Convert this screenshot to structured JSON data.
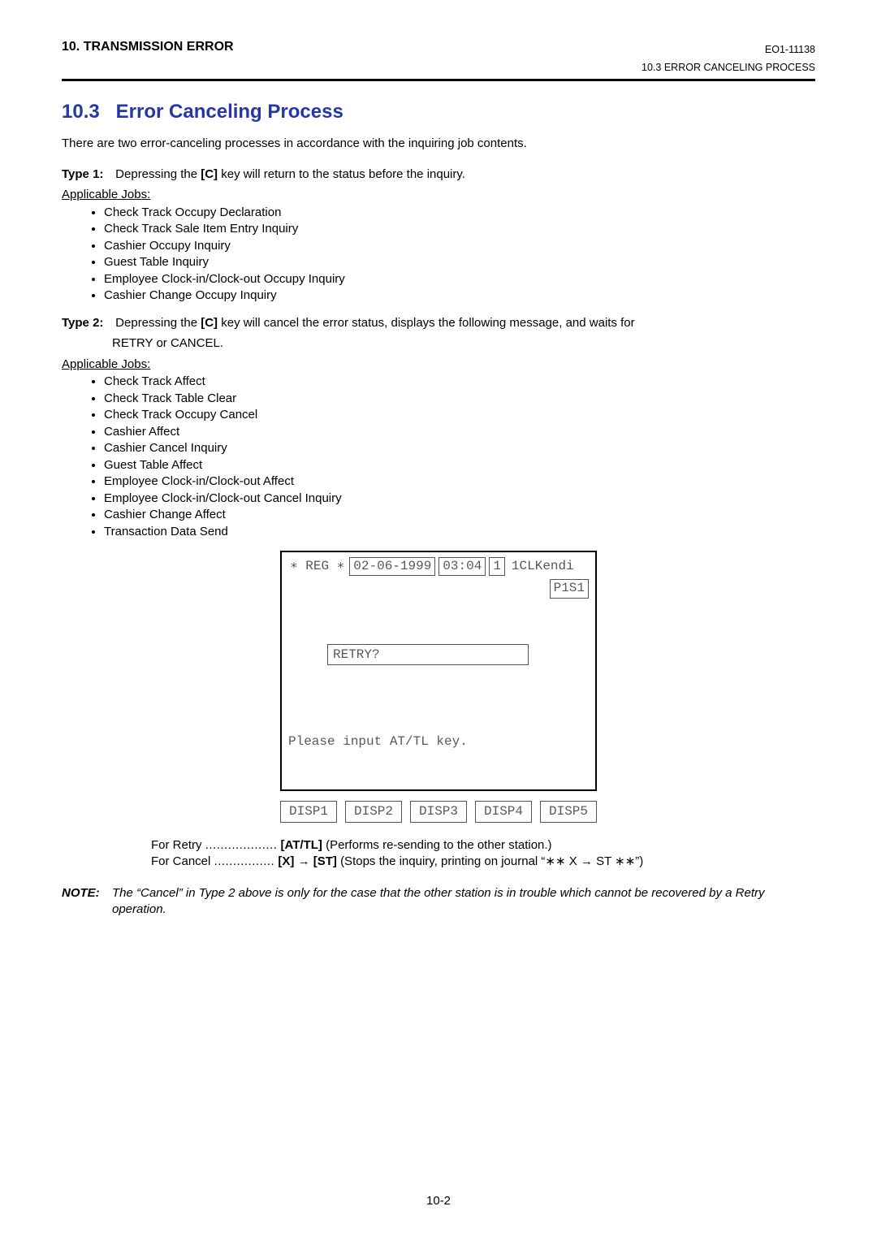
{
  "header": {
    "chapter": "10.  TRANSMISSION ERROR",
    "doc_id": "EO1-11138",
    "sub_right": "10.3  ERROR CANCELING PROCESS"
  },
  "section": {
    "number": "10.3",
    "title": "Error Canceling Process"
  },
  "intro": "There are two error-canceling processes in accordance with the inquiring job contents.",
  "type1": {
    "label": "Type 1:",
    "desc_pre": "Depressing the ",
    "key": "[C]",
    "desc_post": " key will return to the status before the inquiry.",
    "applicable": "Applicable Jobs:",
    "jobs": [
      "Check Track Occupy Declaration",
      "Check Track Sale Item Entry Inquiry",
      "Cashier Occupy Inquiry",
      "Guest Table Inquiry",
      "Employee Clock-in/Clock-out Occupy Inquiry",
      "Cashier Change Occupy Inquiry"
    ]
  },
  "type2": {
    "label": "Type 2:",
    "desc_pre": "Depressing the ",
    "key": "[C]",
    "desc_post": " key will cancel the error status, displays the following message, and waits for",
    "desc_line2": "RETRY or CANCEL.",
    "applicable": "Applicable Jobs:",
    "jobs": [
      "Check Track Affect",
      "Check Track Table Clear",
      "Check Track Occupy Cancel",
      "Cashier Affect",
      "Cashier Cancel Inquiry",
      "Guest Table Affect",
      "Employee Clock-in/Clock-out Affect",
      "Employee Clock-in/Clock-out Cancel Inquiry",
      "Cashier Change Affect",
      "Transaction Data Send"
    ]
  },
  "display": {
    "reg": "∗ REG ∗",
    "date": "02-06-1999",
    "time": "03:04",
    "one": "1",
    "clk": "1CLKendi",
    "p1s1": "P1S1",
    "retry": "RETRY?",
    "prompt": "Please input AT/TL key.",
    "disp": [
      "DISP1",
      "DISP2",
      "DISP3",
      "DISP4",
      "DISP5"
    ]
  },
  "for_block": {
    "retry_label": "For Retry",
    "retry_dots": "...................",
    "retry_key": "[AT/TL]",
    "retry_desc": "(Performs re-sending to the other station.)",
    "cancel_label": "For Cancel",
    "cancel_dots": "................",
    "cancel_keys": "[X]  →  [ST]",
    "cancel_desc": "(Stops the inquiry, printing on journal “∗∗ X  →  ST ∗∗”)"
  },
  "note": {
    "label": "NOTE:",
    "body": "The “Cancel” in Type 2 above is only for the case that the other station is in trouble which cannot be recovered by a Retry operation."
  },
  "page_number": "10-2"
}
